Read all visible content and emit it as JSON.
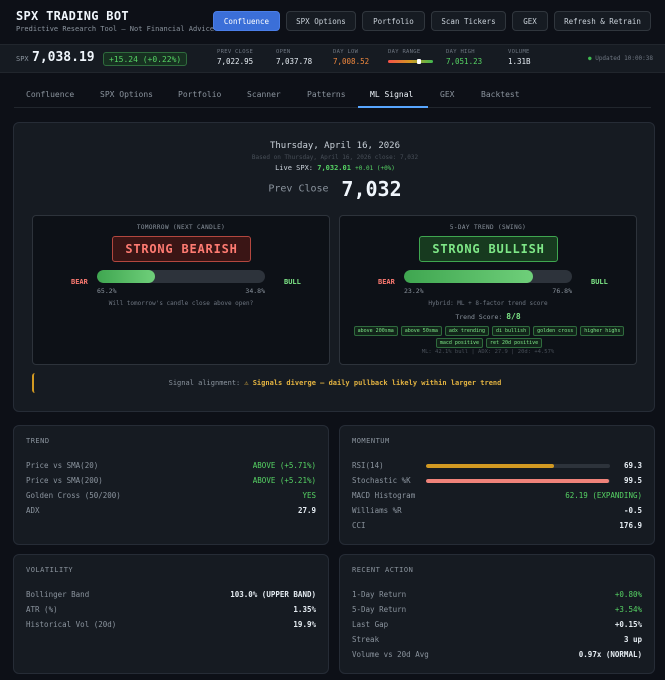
{
  "header": {
    "title": "SPX TRADING BOT",
    "subtitle": "Predictive Research Tool — Not Financial Advice",
    "buttons": [
      {
        "label": "Confluence"
      },
      {
        "label": "SPX Options"
      },
      {
        "label": "Portfolio"
      },
      {
        "label": "Scan Tickers"
      },
      {
        "label": "GEX"
      },
      {
        "label": "Refresh & Retrain"
      }
    ]
  },
  "ticker": {
    "symbol": "SPX",
    "price": "7,038.19",
    "change": "+15.24 (+0.22%)",
    "prev_close_label": "PREV CLOSE",
    "prev_close": "7,022.95",
    "open_label": "OPEN",
    "open": "7,037.78",
    "day_low_label": "DAY LOW",
    "day_low": "7,008.52",
    "day_range_label": "DAY RANGE",
    "day_range_position": 0.68,
    "day_high_label": "DAY HIGH",
    "day_high": "7,051.23",
    "volume_label": "VOLUME",
    "volume": "1.31B",
    "updated": "Updated 10:00:38"
  },
  "tabs": [
    {
      "label": "Confluence"
    },
    {
      "label": "SPX Options"
    },
    {
      "label": "Portfolio"
    },
    {
      "label": "Scanner"
    },
    {
      "label": "Patterns"
    },
    {
      "label": "ML Signal"
    },
    {
      "label": "GEX"
    },
    {
      "label": "Backtest"
    }
  ],
  "active_tab": "ML Signal",
  "ml": {
    "date": "Thursday, April 16, 2026",
    "based_on": "Based on Thursday, April 16, 2026 close: 7,032",
    "live_label": "Live SPX:",
    "live_price": "7,032.01",
    "live_change": "+0.01 (+0%)",
    "prev_close_label": "Prev Close",
    "prev_close": "7,032",
    "tomorrow": {
      "title": "TOMORROW (NEXT CANDLE)",
      "signal": "STRONG BEARISH",
      "bear_label": "BEAR",
      "bull_label": "BULL",
      "bull_fraction": 0.348,
      "bear_pct": "65.2%",
      "bull_pct": "34.8%",
      "note": "Will tomorrow's candle close above open?"
    },
    "swing": {
      "title": "5-DAY TREND (SWING)",
      "signal": "STRONG BULLISH",
      "bear_label": "BEAR",
      "bull_label": "BULL",
      "bull_fraction": 0.768,
      "bear_pct": "23.2%",
      "bull_pct": "76.8%",
      "note": "Hybrid: ML + 8-factor trend score",
      "trend_score_label": "Trend Score:",
      "trend_score": "8/8",
      "chips": [
        "above 200sma",
        "above 50sma",
        "adx trending",
        "di bullish",
        "golden cross",
        "higher highs",
        "macd positive",
        "ret 20d positive"
      ],
      "footer": "ML: 42.1% bull  |  ADX: 27.9  |  20d: +4.57%"
    },
    "alignment_label": "Signal alignment:",
    "alignment_value": "⚠ Signals diverge — daily pullback likely within larger trend"
  },
  "trend": {
    "title": "TREND",
    "rows": [
      {
        "label": "Price vs SMA(20)",
        "value": "ABOVE (+5.71%)"
      },
      {
        "label": "Price vs SMA(200)",
        "value": "ABOVE (+5.21%)"
      },
      {
        "label": "Golden Cross (50/200)",
        "value": "YES"
      },
      {
        "label": "ADX",
        "value": "27.9"
      }
    ]
  },
  "momentum": {
    "title": "MOMENTUM",
    "rows": [
      {
        "label": "RSI(14)",
        "value": "69.3",
        "level": 0.693,
        "color": "#d29922"
      },
      {
        "label": "Stochastic %K",
        "value": "99.5",
        "level": 0.995,
        "color": "#f0837a"
      },
      {
        "label": "MACD Histogram",
        "value": "62.19 (EXPANDING)"
      },
      {
        "label": "Williams %R",
        "value": "-0.5"
      },
      {
        "label": "CCI",
        "value": "176.9"
      }
    ]
  },
  "volatility": {
    "title": "VOLATILITY",
    "rows": [
      {
        "label": "Bollinger Band",
        "value": "103.0% (UPPER BAND)"
      },
      {
        "label": "ATR (%)",
        "value": "1.35%"
      },
      {
        "label": "Historical Vol (20d)",
        "value": "19.9%"
      }
    ]
  },
  "recent": {
    "title": "RECENT ACTION",
    "rows": [
      {
        "label": "1-Day Return",
        "value": "+0.80%"
      },
      {
        "label": "5-Day Return",
        "value": "+3.54%"
      },
      {
        "label": "Last Gap",
        "value": "+0.15%"
      },
      {
        "label": "Streak",
        "value": "3 up"
      },
      {
        "label": "Volume vs 20d Avg",
        "value": "0.97x (NORMAL)"
      }
    ]
  },
  "colors": {
    "accent": "#3b6fd8",
    "bull": "#56d364",
    "bear": "#ff7b72",
    "warning": "#e3b341"
  }
}
